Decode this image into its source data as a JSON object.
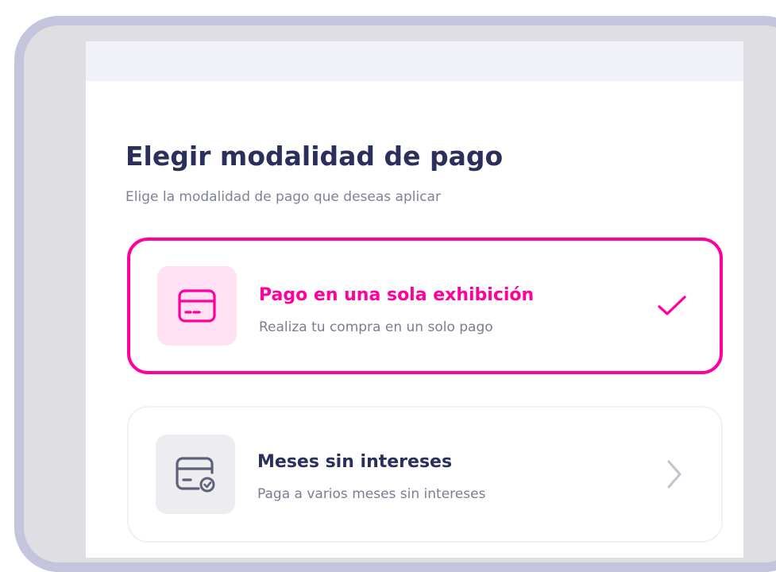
{
  "heading": {
    "title": "Elegir modalidad de pago",
    "subtitle": "Elige la modalidad de pago que deseas aplicar"
  },
  "options": [
    {
      "title": "Pago en una sola exhibición",
      "description": "Realiza tu compra en un solo pago",
      "icon": "credit-card-icon",
      "selected": true,
      "trailing_icon": "check-icon"
    },
    {
      "title": "Meses sin intereses",
      "description": "Paga a varios meses sin intereses",
      "icon": "card-clock-icon",
      "selected": false,
      "trailing_icon": "chevron-right-icon"
    }
  ],
  "colors": {
    "accent": "#ff009d",
    "title": "#2b2f5c",
    "muted": "#7f8199",
    "device_frame": "#c4c4dc"
  }
}
